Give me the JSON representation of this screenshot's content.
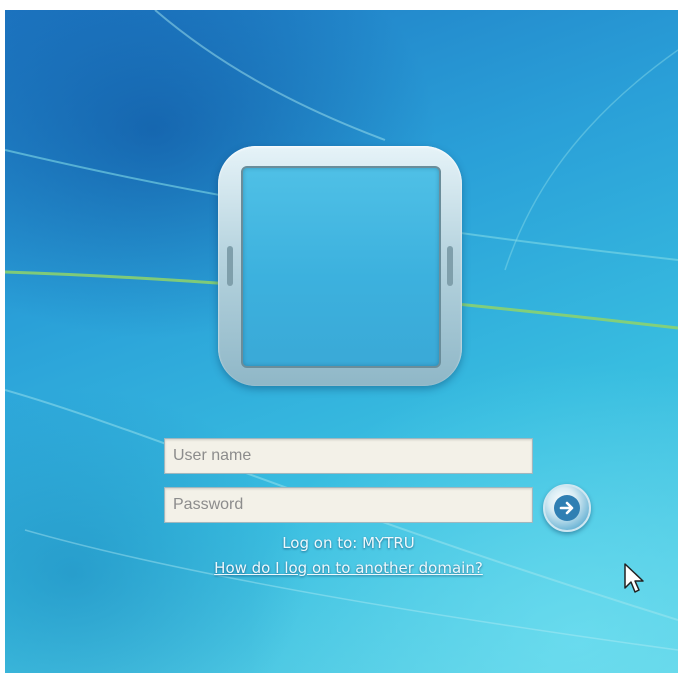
{
  "login": {
    "username_placeholder": "User name",
    "password_placeholder": "Password",
    "logon_to": "Log on to: MYTRU",
    "domain_link": "How do I log on to another domain?"
  },
  "icons": {
    "submit": "arrow-right-icon",
    "cursor": "mouse-pointer-icon",
    "avatar": "user-tile-icon"
  },
  "colors": {
    "background": "#2aa0d8",
    "tile_frame": "#b7d4df",
    "field_bg": "#f3f1e8",
    "text": "#eef8fc"
  }
}
